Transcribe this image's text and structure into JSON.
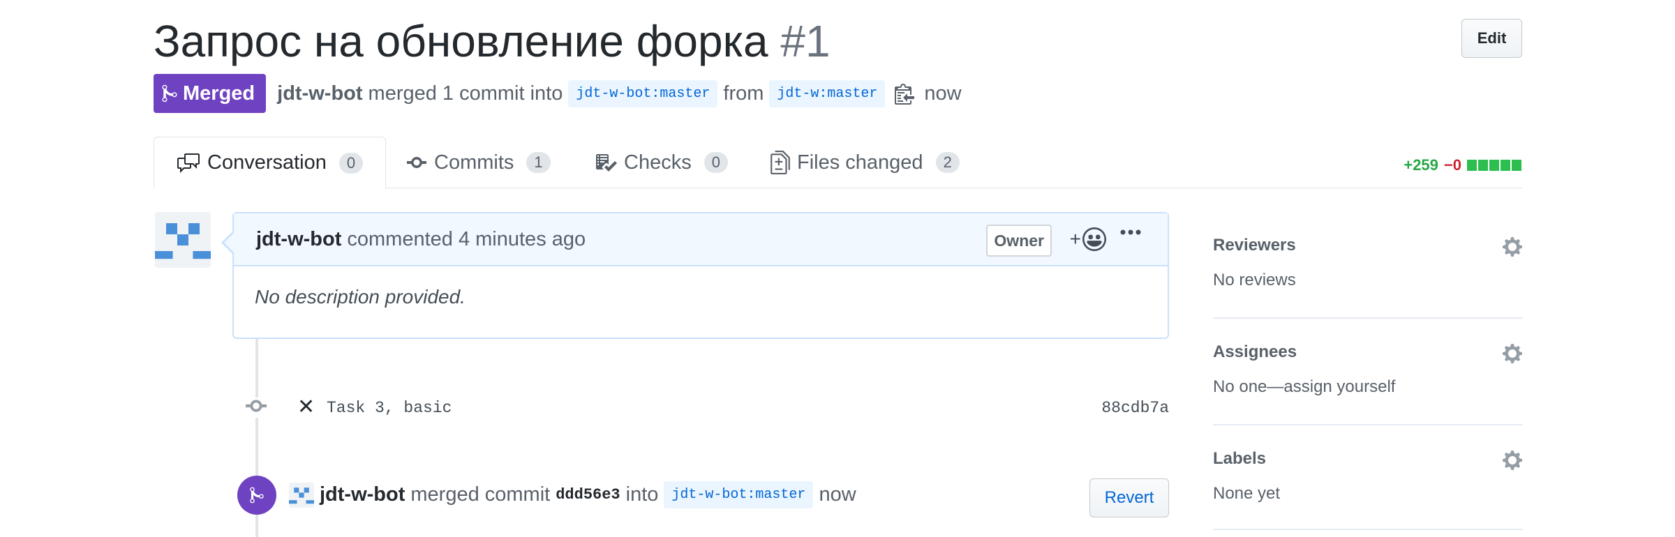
{
  "header": {
    "title": "Запрос на обновление форка",
    "number": "#1",
    "edit_label": "Edit"
  },
  "meta": {
    "state_label": "Merged",
    "author": "jdt-w-bot",
    "action": "merged 1 commit into",
    "base_branch": "jdt-w-bot:master",
    "from_word": "from",
    "head_branch": "jdt-w:master",
    "time": "now"
  },
  "tabs": [
    {
      "label": "Conversation",
      "count": "0",
      "icon": "conversation-icon"
    },
    {
      "label": "Commits",
      "count": "1",
      "icon": "commit-icon"
    },
    {
      "label": "Checks",
      "count": "0",
      "icon": "checklist-icon"
    },
    {
      "label": "Files changed",
      "count": "2",
      "icon": "file-diff-icon"
    }
  ],
  "diffstat": {
    "additions": "+259",
    "deletions": "−0",
    "blocks": 5,
    "add_color": "#28a745",
    "del_color": "#cb2431"
  },
  "comment": {
    "author": "jdt-w-bot",
    "action": "commented 4 minutes ago",
    "owner_badge": "Owner",
    "reaction_plus": "+",
    "body": "No description provided."
  },
  "commit": {
    "status": "✕",
    "message": "Task 3, basic",
    "sha": "88cdb7a"
  },
  "merge_event": {
    "author": "jdt-w-bot",
    "action": "merged commit",
    "sha": "ddd56e3",
    "into_word": "into",
    "branch": "jdt-w-bot:master",
    "time": "now",
    "revert_label": "Revert"
  },
  "sidebar": {
    "sections": [
      {
        "title": "Reviewers",
        "value": "No reviews"
      },
      {
        "title": "Assignees",
        "value": "No one—assign yourself"
      },
      {
        "title": "Labels",
        "value": "None yet"
      }
    ]
  },
  "colors": {
    "merged_purple": "#6f42c1",
    "link_blue": "#0366d6",
    "branch_bg": "#eaf5ff"
  }
}
